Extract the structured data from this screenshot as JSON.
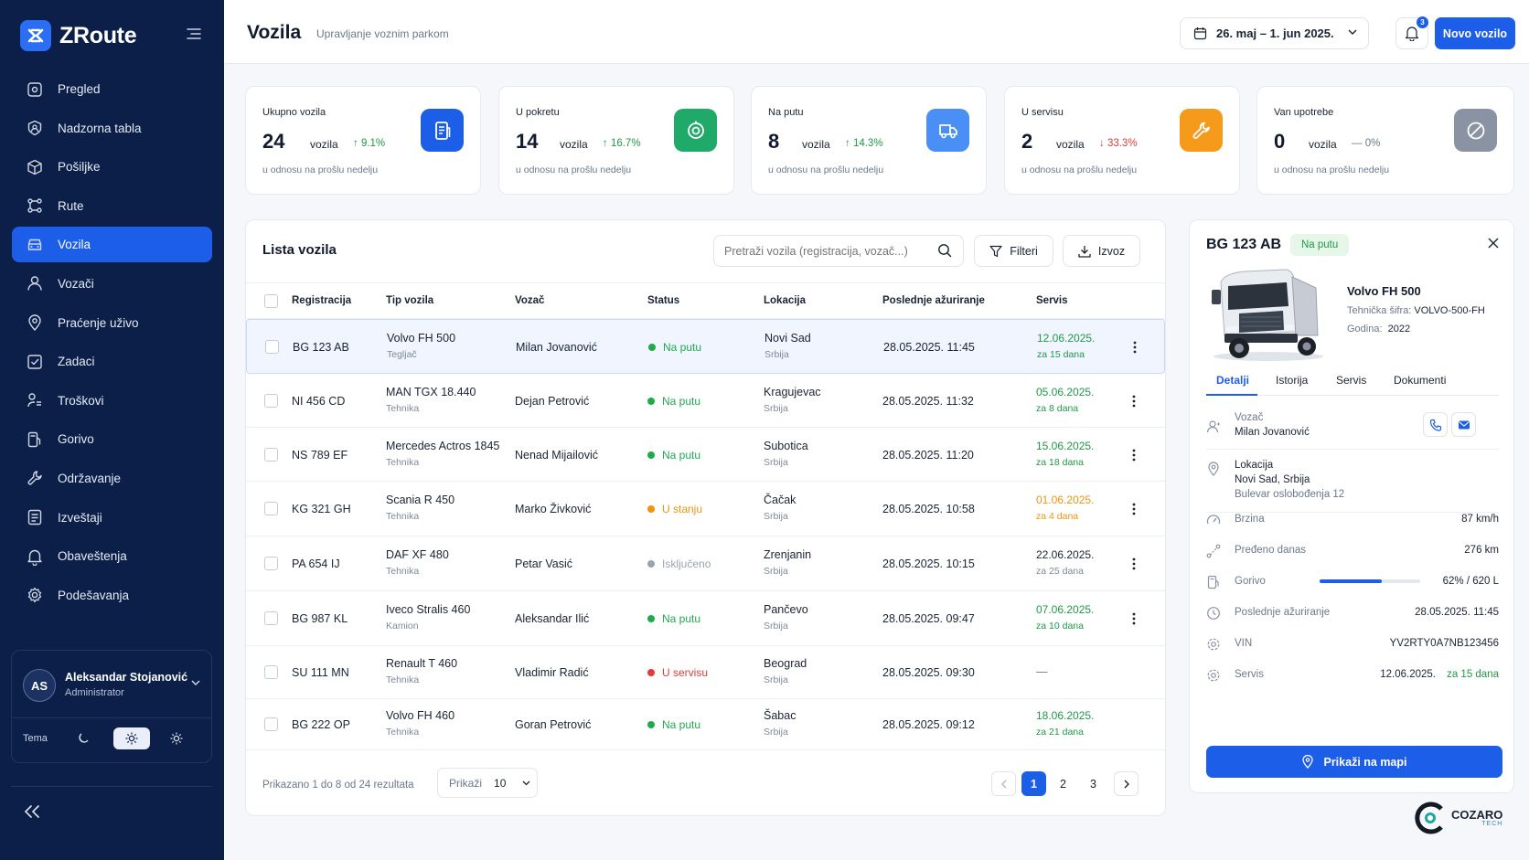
{
  "app": {
    "name": "ZRoute"
  },
  "sidebar": {
    "items": [
      {
        "label": "Pregled",
        "icon": "home-icon"
      },
      {
        "label": "Nadzorna tabla",
        "icon": "dashboard-icon"
      },
      {
        "label": "Pošiljke",
        "icon": "package-icon"
      },
      {
        "label": "Rute",
        "icon": "route-icon"
      },
      {
        "label": "Vozila",
        "icon": "vehicle-icon",
        "active": true
      },
      {
        "label": "Vozači",
        "icon": "user-icon"
      },
      {
        "label": "Praćenje uživo",
        "icon": "location-pin-icon"
      },
      {
        "label": "Zadaci",
        "icon": "tasks-icon"
      },
      {
        "label": "Troškovi",
        "icon": "costs-icon"
      },
      {
        "label": "Gorivo",
        "icon": "fuel-icon"
      },
      {
        "label": "Održavanje",
        "icon": "wrench-icon"
      },
      {
        "label": "Izveštaji",
        "icon": "report-icon"
      },
      {
        "label": "Obaveštenja",
        "icon": "bell-icon"
      },
      {
        "label": "Podešavanja",
        "icon": "gear-icon"
      }
    ],
    "user": {
      "initials": "AS",
      "name": "Aleksandar Stojanović",
      "role": "Administrator"
    },
    "theme": {
      "label": "Tema",
      "selected": "light"
    }
  },
  "header": {
    "title": "Vozila",
    "subtitle": "Upravljanje voznim parkom",
    "date_range": "26. maj – 1. jun 2025.",
    "notifications": "3",
    "new_button": "Novo vozilo"
  },
  "stats": [
    {
      "label": "Ukupno vozila",
      "value": "24",
      "unit": "vozila",
      "trend": "↑ 9.1%",
      "trend_dir": "up",
      "note": "u odnosu na prošlu nedelju",
      "color": "#1d5ee8",
      "icon": "document-icon"
    },
    {
      "label": "U pokretu",
      "value": "14",
      "unit": "vozila",
      "trend": "↑ 16.7%",
      "trend_dir": "up",
      "note": "u odnosu na prošlu nedelju",
      "color": "#1faa6a",
      "icon": "target-icon"
    },
    {
      "label": "Na putu",
      "value": "8",
      "unit": "vozila",
      "trend": "↑ 14.3%",
      "trend_dir": "up",
      "note": "u odnosu na prošlu nedelju",
      "color": "#4a8ff5",
      "icon": "truck-icon"
    },
    {
      "label": "U servisu",
      "value": "2",
      "unit": "vozila",
      "trend": "↓ 33.3%",
      "trend_dir": "down",
      "note": "u odnosu na prošlu nedelju",
      "color": "#f59a1b",
      "icon": "wrench-icon"
    },
    {
      "label": "Van upotrebe",
      "value": "0",
      "unit": "vozila",
      "trend": "— 0%",
      "trend_dir": "flat",
      "note": "u odnosu na prošlu nedelju",
      "color": "#8a93a3",
      "icon": "blocked-icon"
    }
  ],
  "list": {
    "title": "Lista vozila",
    "search_placeholder": "Pretraži vozila (registracija, vozač...)",
    "filter_label": "Filteri",
    "export_label": "Izvoz",
    "columns": [
      "Registracija",
      "Tip vozila",
      "Vozač",
      "Status",
      "Lokacija",
      "Poslednje ažuriranje",
      "Servis"
    ],
    "rows": [
      {
        "reg": "BG 123 AB",
        "type": "Volvo FH 500",
        "type_sub": "Tegljač",
        "driver": "Milan Jovanović",
        "status": "Na putu",
        "status_color": "#1faa4e",
        "city": "Novi Sad",
        "country": "Srbija",
        "updated": "28.05.2025. 11:45",
        "service": "12.06.2025.",
        "service_sub": "za 15 dana",
        "service_color": "#1f9a45",
        "selected": true
      },
      {
        "reg": "NI 456 CD",
        "type": "MAN TGX 18.440",
        "type_sub": "Tehnika",
        "driver": "Dejan Petrović",
        "status": "Na putu",
        "status_color": "#1faa4e",
        "city": "Kragujevac",
        "country": "Srbija",
        "updated": "28.05.2025. 11:32",
        "service": "05.06.2025.",
        "service_sub": "za 8 dana",
        "service_color": "#1f9a45"
      },
      {
        "reg": "NS 789 EF",
        "type": "Mercedes Actros 1845",
        "type_sub": "Tehnika",
        "driver": "Nenad Mijailović",
        "status": "Na putu",
        "status_color": "#1faa4e",
        "city": "Subotica",
        "country": "Srbija",
        "updated": "28.05.2025. 11:20",
        "service": "15.06.2025.",
        "service_sub": "za 18 dana",
        "service_color": "#1f9a45"
      },
      {
        "reg": "KG 321 GH",
        "type": "Scania R 450",
        "type_sub": "Tehnika",
        "driver": "Marko Živković",
        "status": "U stanju",
        "status_color": "#f0930f",
        "city": "Čačak",
        "country": "Srbija",
        "updated": "28.05.2025. 10:58",
        "service": "01.06.2025.",
        "service_sub": "za 4 dana",
        "service_color": "#f0930f"
      },
      {
        "reg": "PA 654 IJ",
        "type": "DAF XF 480",
        "type_sub": "Tehnika",
        "driver": "Petar Vasić",
        "status": "Isključeno",
        "status_color": "#9aa2b0",
        "city": "Zrenjanin",
        "country": "Srbija",
        "updated": "28.05.2025. 10:15",
        "service": "22.06.2025.",
        "service_sub": "za 25 dana",
        "service_color": "#1a2233"
      },
      {
        "reg": "BG 987 KL",
        "type": "Iveco Stralis 460",
        "type_sub": "Kamion",
        "driver": "Aleksandar Ilić",
        "status": "Na putu",
        "status_color": "#1faa4e",
        "city": "Pančevo",
        "country": "Srbija",
        "updated": "28.05.2025. 09:47",
        "service": "07.06.2025.",
        "service_sub": "za 10 dana",
        "service_color": "#1f9a45"
      },
      {
        "reg": "SU 111 MN",
        "type": "Renault T 460",
        "type_sub": "Tehnika",
        "driver": "Vladimir Radić",
        "status": "U servisu",
        "status_color": "#e23a3a",
        "city": "Beograd",
        "country": "Srbija",
        "updated": "28.05.2025. 09:30",
        "service": "—",
        "service_sub": "",
        "service_color": "#6c778c",
        "no_menu": true
      },
      {
        "reg": "BG 222 OP",
        "type": "Volvo FH 460",
        "type_sub": "Tehnika",
        "driver": "Goran Petrović",
        "status": "Na putu",
        "status_color": "#1faa4e",
        "city": "Šabac",
        "country": "Srbija",
        "updated": "28.05.2025. 09:12",
        "service": "18.06.2025.",
        "service_sub": "za 21 dana",
        "service_color": "#1f9a45",
        "no_menu": true
      }
    ],
    "pagination": {
      "info": "Prikazano 1 do 8 od 24 rezultata",
      "show_label": "Prikaži",
      "per_page": "10",
      "pages": [
        "1",
        "2",
        "3"
      ],
      "current": "1"
    }
  },
  "detail": {
    "plate": "BG 123 AB",
    "status": "Na putu",
    "model": "Volvo FH 500",
    "code_label": "Tehnička šifra:",
    "code": "VOLVO-500-FH",
    "year_label": "Godina:",
    "year": "2022",
    "tabs": [
      "Detalji",
      "Istorija",
      "Servis",
      "Dokumenti"
    ],
    "driver_label": "Vozač",
    "driver": "Milan Jovanović",
    "location_label": "Lokacija",
    "location": "Novi Sad, Srbija",
    "address": "Bulevar oslobođenja 12",
    "speed_label": "Brzina",
    "speed": "87 km/h",
    "distance_label": "Pređeno danas",
    "distance": "276 km",
    "fuel_label": "Gorivo",
    "fuel": "62% / 620 L",
    "fuel_fraction": 0.62,
    "updated_label": "Poslednje ažuriranje",
    "updated": "28.05.2025. 11:45",
    "vin_label": "VIN",
    "vin": "YV2RTY0A7NB123456",
    "service_label": "Servis",
    "service_date": "12.06.2025.",
    "service_due": "za 15 dana",
    "map_button": "Prikaži na mapi"
  },
  "brand": {
    "name": "COZARO",
    "sub": "TECH"
  }
}
